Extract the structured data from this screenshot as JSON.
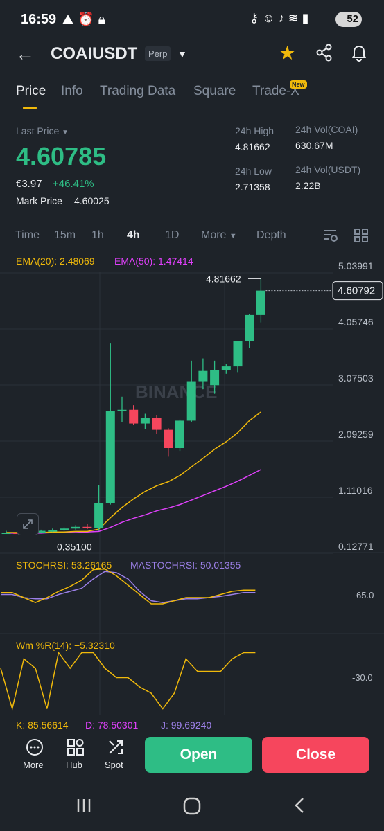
{
  "status_bar": {
    "time": "16:59",
    "battery": "52",
    "left_icons": [
      "mountain-icon",
      "alarm-icon",
      "lock-icon"
    ],
    "right_icons": [
      "key-icon",
      "face-icon",
      "mute-icon",
      "wifi-icon",
      "signal-icon"
    ]
  },
  "header": {
    "symbol": "COAIUSDT",
    "badge": "Perp"
  },
  "tabs": [
    {
      "label": "Price",
      "active": true
    },
    {
      "label": "Info",
      "active": false
    },
    {
      "label": "Trading Data",
      "active": false
    },
    {
      "label": "Square",
      "active": false
    },
    {
      "label": "Trade-X",
      "active": false,
      "badge": "New"
    }
  ],
  "ticker": {
    "last_price_label": "Last Price",
    "last_price": "4.60785",
    "fiat_price": "€3.97",
    "change": "+46.41%",
    "mark_price_label": "Mark Price",
    "mark_price": "4.60025",
    "high_label": "24h High",
    "high": "4.81662",
    "low_label": "24h Low",
    "low": "2.71358",
    "vol_coin_label": "24h Vol(COAI)",
    "vol_coin": "630.67M",
    "vol_usdt_label": "24h Vol(USDT)",
    "vol_usdt": "2.22B"
  },
  "intervals": [
    {
      "label": "Time",
      "active": false
    },
    {
      "label": "15m",
      "active": false
    },
    {
      "label": "1h",
      "active": false
    },
    {
      "label": "4h",
      "active": true
    },
    {
      "label": "1D",
      "active": false
    },
    {
      "label": "More",
      "active": false
    },
    {
      "label": "Depth",
      "active": false
    }
  ],
  "indicators": {
    "ema20": "EMA(20): 2.48069",
    "ema50": "EMA(50): 1.47414",
    "stochrsi": "STOCHRSI: 53.26165",
    "mastochrsi": "MASTOCHRSI: 50.01355",
    "wr": "Wm %R(14): −5.32310",
    "k": "K: 85.56614",
    "d": "D: 78.50301",
    "j": "J: 99.69240"
  },
  "chart_labels": {
    "watermark": "BINANCE",
    "high_marker": "4.81662",
    "low_marker": "0.35100",
    "current_price_tag": "4.60792",
    "stoch_axis": "65.0",
    "wr_axis": "-30.0"
  },
  "colors": {
    "up": "#2ebd85",
    "down": "#f6465d",
    "accent": "#f0b90b",
    "ema20": "#f0b90b",
    "ema50": "#e040fb",
    "stoch": "#f0b90b",
    "mastoch": "#9b7fe6"
  },
  "chart_data": {
    "type": "candlestick",
    "y_axis_ticks": [
      "5.03991",
      "4.05746",
      "3.07503",
      "2.09259",
      "1.11016",
      "0.12771"
    ],
    "ylim": [
      0.12771,
      5.03991
    ],
    "candles": [
      {
        "o": 0.36,
        "h": 0.4,
        "l": 0.35,
        "c": 0.37
      },
      {
        "o": 0.37,
        "h": 0.4,
        "l": 0.35,
        "c": 0.36
      },
      {
        "o": 0.36,
        "h": 0.39,
        "l": 0.35,
        "c": 0.37
      },
      {
        "o": 0.37,
        "h": 0.42,
        "l": 0.36,
        "c": 0.4
      },
      {
        "o": 0.4,
        "h": 0.44,
        "l": 0.38,
        "c": 0.41
      },
      {
        "o": 0.41,
        "h": 0.46,
        "l": 0.4,
        "c": 0.44
      },
      {
        "o": 0.44,
        "h": 0.5,
        "l": 0.42,
        "c": 0.47
      },
      {
        "o": 0.47,
        "h": 0.52,
        "l": 0.43,
        "c": 0.45
      },
      {
        "o": 0.45,
        "h": 1.2,
        "l": 0.4,
        "c": 0.88
      },
      {
        "o": 0.88,
        "h": 3.68,
        "l": 0.86,
        "c": 2.5
      },
      {
        "o": 2.5,
        "h": 2.75,
        "l": 2.3,
        "c": 2.52
      },
      {
        "o": 2.52,
        "h": 2.6,
        "l": 2.25,
        "c": 2.28
      },
      {
        "o": 2.28,
        "h": 2.45,
        "l": 2.18,
        "c": 2.38
      },
      {
        "o": 2.38,
        "h": 2.42,
        "l": 2.1,
        "c": 2.17
      },
      {
        "o": 2.17,
        "h": 2.2,
        "l": 1.7,
        "c": 1.85
      },
      {
        "o": 1.85,
        "h": 2.35,
        "l": 1.8,
        "c": 2.33
      },
      {
        "o": 2.33,
        "h": 3.38,
        "l": 2.3,
        "c": 3.02
      },
      {
        "o": 3.02,
        "h": 3.42,
        "l": 2.88,
        "c": 3.2
      },
      {
        "o": 2.95,
        "h": 3.38,
        "l": 2.8,
        "c": 3.22
      },
      {
        "o": 3.22,
        "h": 3.32,
        "l": 3.15,
        "c": 3.28
      },
      {
        "o": 3.28,
        "h": 3.58,
        "l": 3.18,
        "c": 3.72
      },
      {
        "o": 3.72,
        "h": 4.2,
        "l": 3.6,
        "c": 4.18
      },
      {
        "o": 4.18,
        "h": 4.81662,
        "l": 4.05,
        "c": 4.60792
      }
    ],
    "ema20_values": [
      0.37,
      0.37,
      0.37,
      0.37,
      0.38,
      0.38,
      0.39,
      0.39,
      0.43,
      0.63,
      0.81,
      0.96,
      1.09,
      1.19,
      1.26,
      1.37,
      1.52,
      1.67,
      1.83,
      1.96,
      2.12,
      2.33,
      2.48069
    ],
    "ema50_values": [
      0.36,
      0.36,
      0.36,
      0.36,
      0.37,
      0.37,
      0.37,
      0.38,
      0.39,
      0.46,
      0.55,
      0.62,
      0.68,
      0.75,
      0.8,
      0.86,
      0.94,
      1.02,
      1.1,
      1.18,
      1.27,
      1.37,
      1.47414
    ],
    "stoch_values": [
      0.58,
      0.58,
      0.5,
      0.42,
      0.5,
      0.6,
      0.68,
      0.78,
      0.95,
      0.96,
      0.85,
      0.7,
      0.55,
      0.4,
      0.4,
      0.45,
      0.5,
      0.5,
      0.5,
      0.55,
      0.6,
      0.62,
      0.62
    ],
    "mastoch_values": [
      0.55,
      0.55,
      0.5,
      0.48,
      0.48,
      0.55,
      0.6,
      0.65,
      0.8,
      0.92,
      0.9,
      0.8,
      0.6,
      0.45,
      0.42,
      0.45,
      0.48,
      0.48,
      0.5,
      0.52,
      0.55,
      0.58,
      0.58
    ],
    "wr_values": [
      0.7,
      0.05,
      0.85,
      0.7,
      0.05,
      0.95,
      0.7,
      0.95,
      0.95,
      0.7,
      0.55,
      0.55,
      0.4,
      0.3,
      0.05,
      0.3,
      0.85,
      0.65,
      0.65,
      0.65,
      0.85,
      0.95,
      0.95
    ]
  }
}
